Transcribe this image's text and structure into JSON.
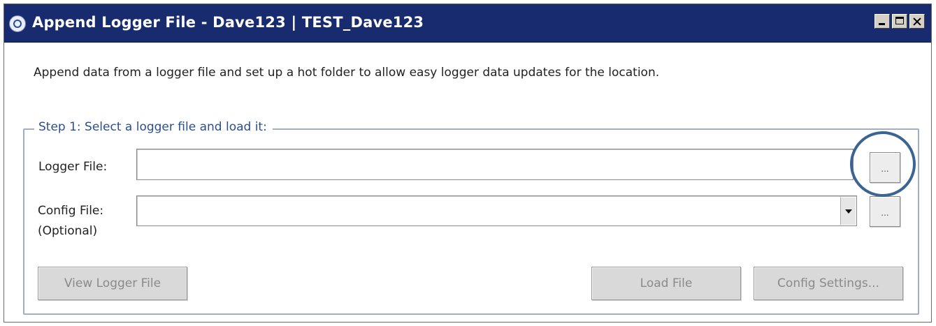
{
  "window": {
    "title": "Append Logger File - Dave123 | TEST_Dave123",
    "icon": "app-logo-icon",
    "controls": [
      "minimize-icon",
      "maximize-icon",
      "close-icon"
    ]
  },
  "description": "Append data from a logger file and set up a hot folder to allow easy logger data updates for the location.",
  "step1": {
    "legend": "Step 1: Select a logger file and load it:",
    "logger_file": {
      "label": "Logger File:",
      "value": "",
      "browse_label": "..."
    },
    "config_file": {
      "label": "Config File:",
      "label_optional": "(Optional)",
      "value": "",
      "browse_label": "..."
    },
    "buttons": {
      "view_logger": "View Logger File",
      "load_file": "Load File",
      "config_settings": "Config Settings..."
    }
  },
  "colors": {
    "titlebar": "#182b6e",
    "legend_text": "#2a4f8f",
    "group_border": "#9fb0c2",
    "highlight": "#3a6592",
    "disabled_text": "#8a8a8a"
  }
}
